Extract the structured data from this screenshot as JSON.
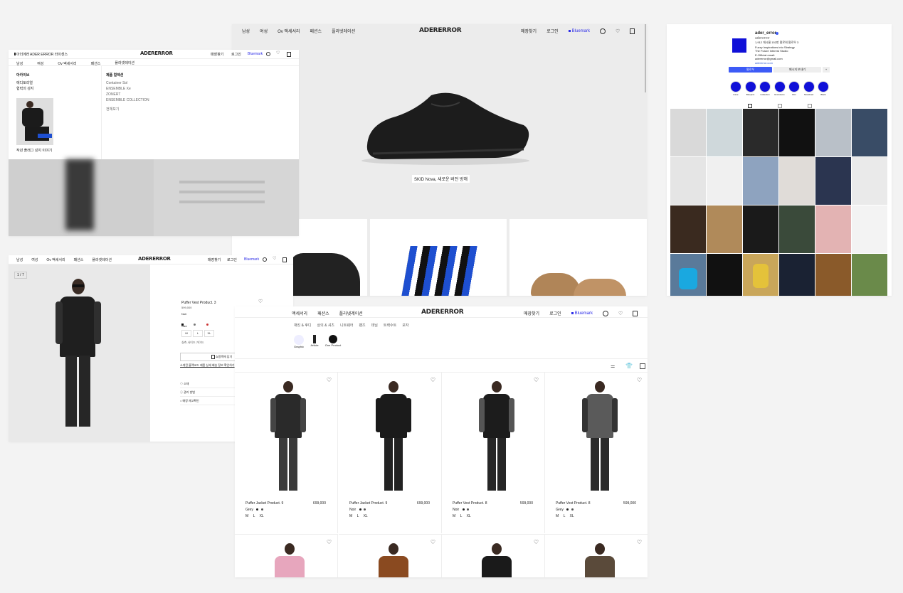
{
  "home": {
    "nav_left": [
      "남성",
      "여성",
      "Ov 액세서리",
      "패션스",
      "플라넷레이션"
    ],
    "logo": "ADERERROR",
    "nav_right": [
      "매장찾기",
      "로그인"
    ],
    "bluemark": "Bluemark",
    "hero_caption": "SKID Nova, 새로운 버전 방해"
  },
  "menu": {
    "top_left": [
      "아더에러",
      "ADER ERROR 라이센스"
    ],
    "logo": "ADERERROR",
    "top_right": [
      "매장찾기",
      "로그인"
    ],
    "bluemark": "Bluemark",
    "nav": [
      "남성",
      "여성",
      "Ov 액세서리",
      "패션스",
      "플라넷레이션"
    ],
    "col1_title": "아카이브",
    "col1_items": [
      "에디토리얼",
      "협력의 성지"
    ],
    "image_caption": "작년 플래그 성지 이야기",
    "col2_title": "제품 컬렉션",
    "col2_items": [
      "Container Sol",
      "ENSEMBLE Xe",
      "ZONERT",
      "ENSEMBLE COLLECTION"
    ],
    "col2_extra": "전체보기"
  },
  "product": {
    "nav": [
      "남성",
      "여성",
      "Ov 액세서리",
      "패션스",
      "플라넷레이션"
    ],
    "logo": "ADERERROR",
    "top_right": [
      "매장찾기",
      "로그인"
    ],
    "bluemark": "Bluemark",
    "counter": "1 / 7",
    "name": "Puffer Vest Product. 3",
    "price": "599,000",
    "color_label": "Noir",
    "size_label": "Size",
    "sizes": [
      "M",
      "L",
      "XL"
    ],
    "size_guide": "실측 사이즈 가이드",
    "cart_button": "쇼핑백에 담기",
    "info_link": "소개된 블랙코드 제품 상세 배송 정보 확인하기",
    "details": [
      "소재",
      "관리 방법",
      "매장 재고확인"
    ]
  },
  "listing": {
    "nav_partial": [
      "액세서리",
      "패션스",
      "플라넷레이션"
    ],
    "logo": "ADERERROR",
    "top_right": [
      "매장찾기",
      "로그인"
    ],
    "bluemark": "Bluemark",
    "categories": [
      "재킷 & 후디",
      "상의 & 셔츠",
      "니트웨어",
      "팬츠",
      "데님",
      "트랙수트",
      "모자"
    ],
    "thumbs": [
      "Graphic",
      "Article",
      "One Product"
    ],
    "products": [
      {
        "name": "Puffer Jacket Product. 9",
        "price": "699,000",
        "color": "Grey",
        "sizes": [
          "M",
          "L",
          "XL"
        ]
      },
      {
        "name": "Puffer Jacket Product. 9",
        "price": "699,000",
        "color": "Noir",
        "sizes": [
          "M",
          "L",
          "XL"
        ]
      },
      {
        "name": "Puffer Vest Product. 8",
        "price": "599,000",
        "color": "Noir",
        "sizes": [
          "M",
          "L",
          "XL"
        ]
      },
      {
        "name": "Puffer Vest Product. 8",
        "price": "599,000",
        "color": "Grey",
        "sizes": [
          "M",
          "L",
          "XL"
        ]
      }
    ]
  },
  "instagram": {
    "handle": "ader_error",
    "subtitle": "adererror",
    "stats": "1,912 게시물  152만 팔로워  팔로우 3",
    "bio": [
      "Fuzzy Inspirations into Strategy",
      "The Future Interest Studio"
    ],
    "email": "E-Official-email: adererror@gmail.com",
    "link": "adererror.com",
    "follow": "팔로우",
    "message": "메시지 보내기",
    "highlights": [
      "Issue",
      "Bluepins",
      "Collection",
      "Exclusives",
      "Film",
      "Newsfeed",
      "Black"
    ]
  },
  "colors": {
    "bluemark": "#2d2de8",
    "ig_blue": "#3d5bf6",
    "highlight_blue": "#1010d8"
  }
}
